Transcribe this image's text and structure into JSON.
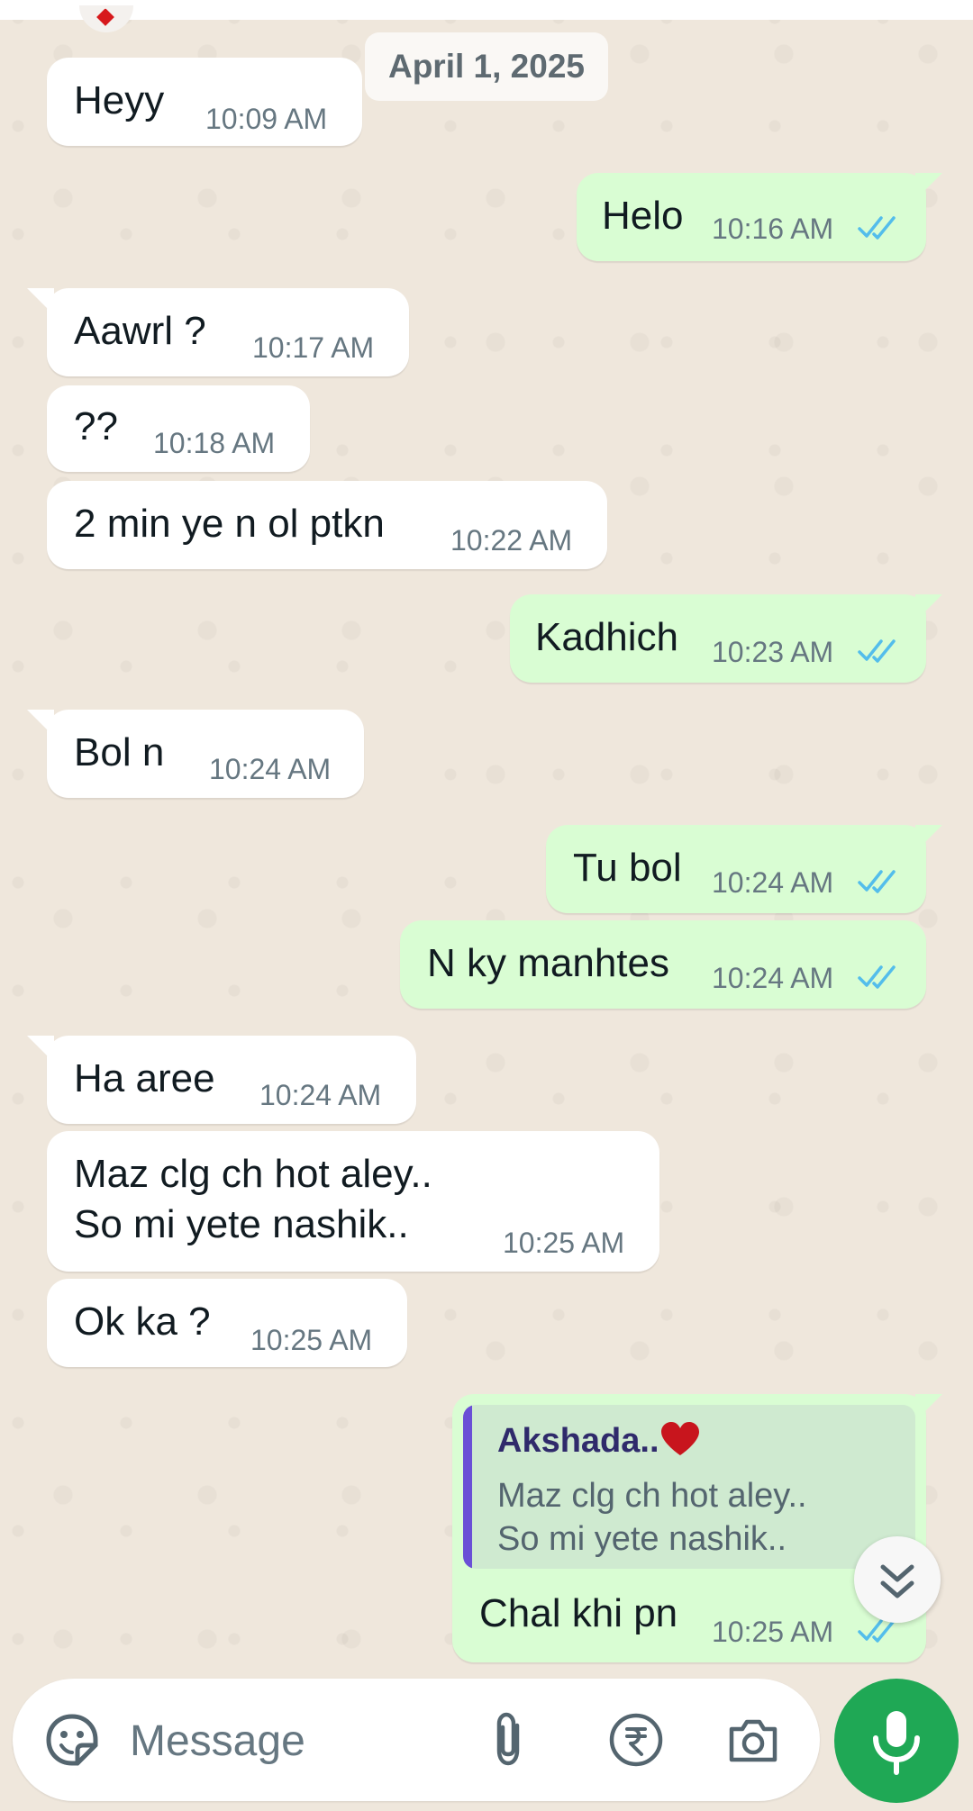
{
  "date_chip": "April 1, 2025",
  "messages": [
    {
      "dir": "in",
      "text": "Heyy",
      "time": "10:09 AM"
    },
    {
      "dir": "out",
      "text": "Helo",
      "time": "10:16 AM"
    },
    {
      "dir": "in",
      "text": "Aawrl ?",
      "time": "10:17 AM"
    },
    {
      "dir": "in",
      "text": "??",
      "time": "10:18 AM"
    },
    {
      "dir": "in",
      "text": "2 min ye n ol ptkn",
      "time": "10:22 AM"
    },
    {
      "dir": "out",
      "text": "Kadhich",
      "time": "10:23 AM"
    },
    {
      "dir": "in",
      "text": "Bol n",
      "time": "10:24 AM"
    },
    {
      "dir": "out",
      "text": "Tu bol",
      "time": "10:24 AM"
    },
    {
      "dir": "out",
      "text": "N ky manhtes",
      "time": "10:24 AM"
    },
    {
      "dir": "in",
      "text": "Ha aree",
      "time": "10:24 AM"
    },
    {
      "dir": "in",
      "text": "Maz clg ch hot aley..",
      "text2": "So mi yete nashik..",
      "time": "10:25 AM"
    },
    {
      "dir": "in",
      "text": "Ok ka ?",
      "time": "10:25 AM"
    },
    {
      "dir": "out",
      "text": "Chal khi pn",
      "time": "10:25 AM",
      "quote": {
        "author": "Akshada..",
        "line1": "Maz clg ch hot aley..",
        "line2": "So mi yete nashik.."
      }
    }
  ],
  "composer": {
    "placeholder": "Message"
  },
  "icons": {
    "emoji": "sticker-smiley-icon",
    "attach": "paperclip-icon",
    "rupee": "rupee-payment-icon",
    "camera": "camera-icon",
    "mic": "microphone-icon",
    "scroll": "double-chevron-down-icon",
    "ticks": "double-check-read-icon",
    "heart": "heart-icon"
  },
  "colors": {
    "in": "#ffffff",
    "out": "#d9fdd3",
    "read_ticks": "#53bdeb",
    "mic_bg": "#1fa855",
    "quote_bar": "#6a4fd6"
  }
}
